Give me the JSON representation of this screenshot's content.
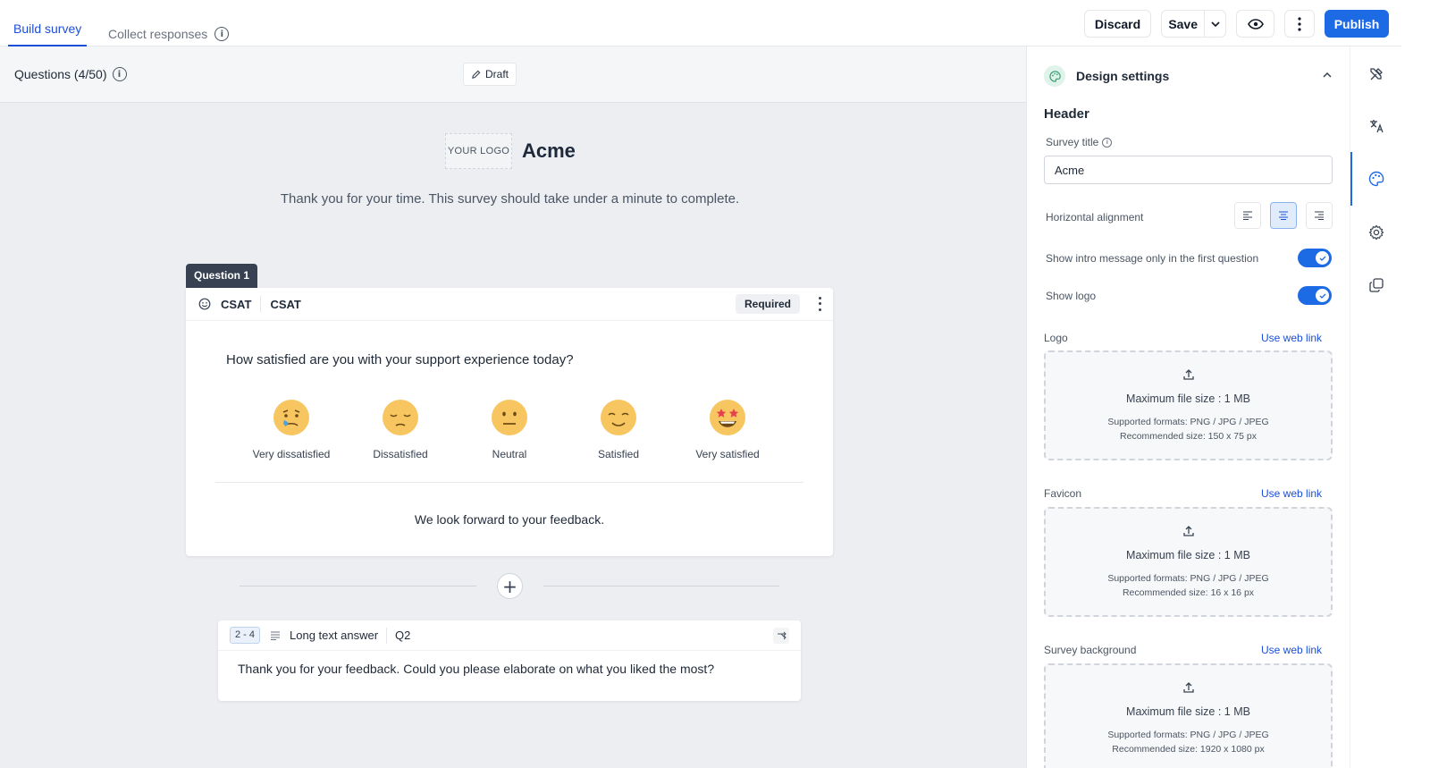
{
  "tabs": [
    {
      "label": "Build survey",
      "active": true
    },
    {
      "label": "Collect responses",
      "active": false
    }
  ],
  "toolbar": {
    "discard": "Discard",
    "save": "Save",
    "publish": "Publish"
  },
  "questions_bar": {
    "count": "Questions (4/50)",
    "status": "Draft"
  },
  "survey": {
    "logo_placeholder": "YOUR LOGO",
    "title": "Acme",
    "intro": "Thank you for your time. This survey should take under a minute to complete."
  },
  "question1": {
    "tag": "Question 1",
    "type": "CSAT",
    "name": "CSAT",
    "required": "Required",
    "text": "How satisfied are you with your support experience today?",
    "options": [
      "Very dissatisfied",
      "Dissatisfied",
      "Neutral",
      "Satisfied",
      "Very satisfied"
    ],
    "footer": "We look forward to your feedback."
  },
  "question2": {
    "range": "2 - 4",
    "type": "Long text answer",
    "name": "Q2",
    "text": "Thank you for your feedback. Could you please elaborate on what you liked the most?"
  },
  "panel": {
    "title": "Design settings",
    "section": "Header",
    "survey_title_label": "Survey title",
    "survey_title_value": "Acme",
    "alignment_label": "Horizontal alignment",
    "intro_toggle_label": "Show intro message only in the first question",
    "intro_toggle_on": true,
    "logo_toggle_label": "Show logo",
    "logo_toggle_on": true,
    "uploads": [
      {
        "label": "Logo",
        "link": "Use web link",
        "max": "Maximum file size : 1 MB",
        "formats": "Supported formats: PNG / JPG / JPEG",
        "size": "Recommended size: 150 x 75 px"
      },
      {
        "label": "Favicon",
        "link": "Use web link",
        "max": "Maximum file size : 1 MB",
        "formats": "Supported formats: PNG / JPG / JPEG",
        "size": "Recommended size: 16 x 16 px"
      },
      {
        "label": "Survey background",
        "link": "Use web link",
        "max": "Maximum file size : 1 MB",
        "formats": "Supported formats: PNG / JPG / JPEG",
        "size": "Recommended size: 1920 x 1080 px"
      }
    ]
  },
  "rail": [
    "tools-icon",
    "translate-icon",
    "palette-icon",
    "settings-icon",
    "copy-icon"
  ],
  "colors": {
    "accent": "#1d6ae5",
    "canvas": "#eceef2",
    "emoji": "#f7c661"
  }
}
